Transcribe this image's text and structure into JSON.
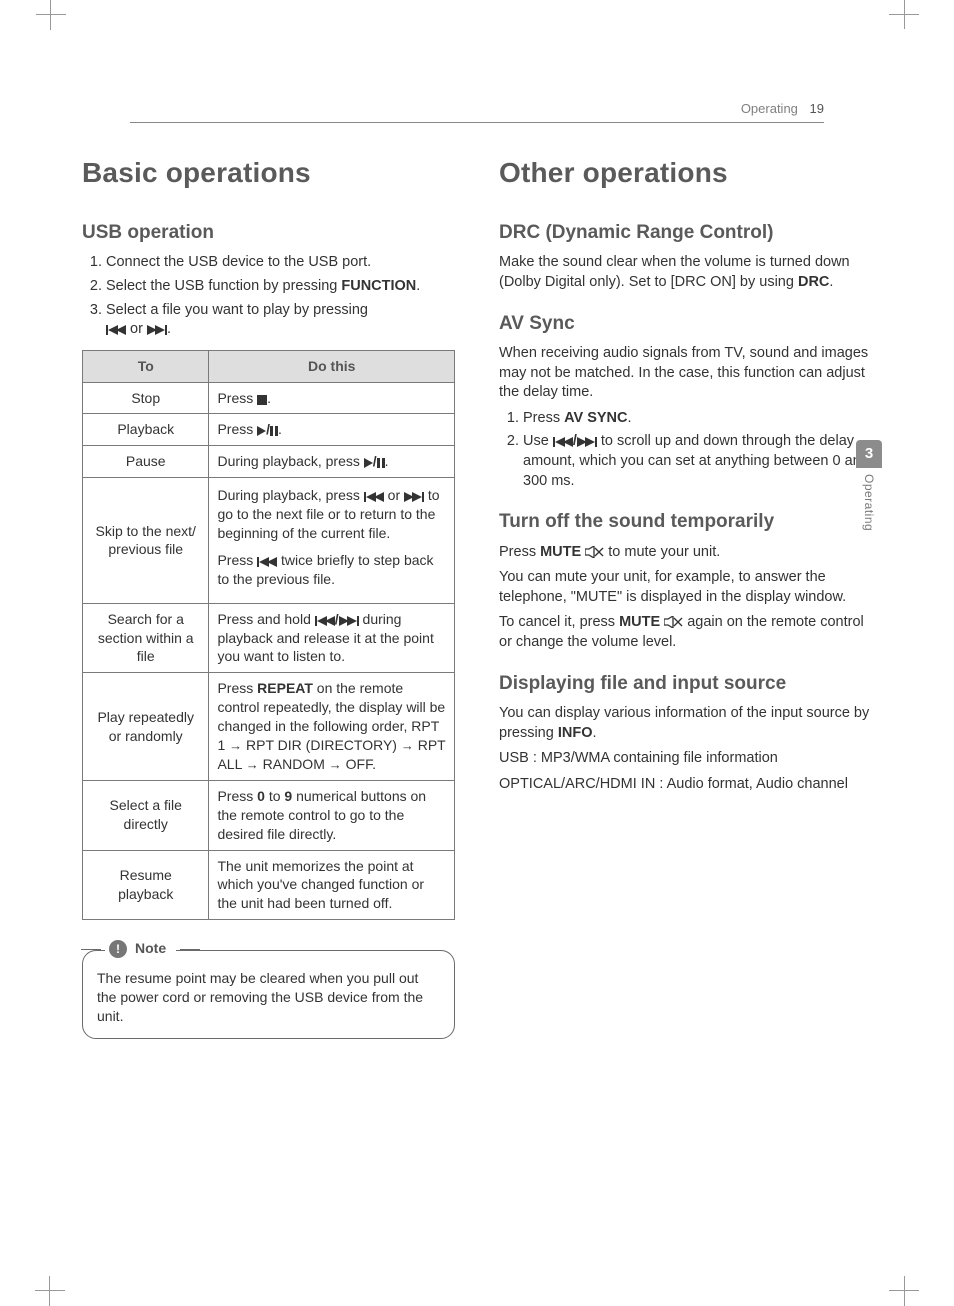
{
  "header": {
    "section": "Operating",
    "page": "19"
  },
  "sidetab": {
    "number": "3",
    "label": "Operating"
  },
  "left": {
    "h1": "Basic operations",
    "usb_h2": "USB operation",
    "steps": {
      "s1": "Connect the USB device to the USB port.",
      "s2_a": "Select the USB function by pressing ",
      "s2_b": "FUNCTION",
      "s3_a": "Select a file you want to play by pressing ",
      "s3_b": " or "
    },
    "table": {
      "th_to": "To",
      "th_do": "Do this",
      "stop_to": "Stop",
      "stop_do": "Press ",
      "play_to": "Playback",
      "play_do": "Press ",
      "pause_to": "Pause",
      "pause_do": "During playback, press ",
      "skip_to": "Skip to the next/ previous file",
      "skip_do_a": "During playback, press ",
      "skip_do_b": " or ",
      "skip_do_c": " to go to the next file or to return to the beginning of the current file.",
      "skip_do_d": "Press ",
      "skip_do_e": " twice briefly to step back to the previous file.",
      "search_to": "Search for a section within a file",
      "search_do_a": "Press and hold ",
      "search_do_b": " during playback and release it at the point you want to listen to.",
      "repeat_to": "Play repeatedly or randomly",
      "repeat_do_a": "Press ",
      "repeat_do_b": "REPEAT",
      "repeat_do_c": " on the remote control repeatedly, the display will be changed in the following order, RPT 1 ",
      "repeat_do_d": " RPT DIR (DIRECTORY) ",
      "repeat_do_e": " RPT ALL ",
      "repeat_do_f": " RANDOM ",
      "repeat_do_g": " OFF.",
      "direct_to": "Select a file directly",
      "direct_do_a": "Press ",
      "direct_do_b": "0",
      "direct_do_c": " to ",
      "direct_do_d": "9",
      "direct_do_e": " numerical buttons on the remote control to go to the desired file directly.",
      "resume_to": "Resume playback",
      "resume_do": "The unit memorizes the point at which you've changed function or the unit had been turned off."
    },
    "note_title": "Note",
    "note_body": "The resume point may be cleared when you pull out the power cord or removing the USB device from the unit."
  },
  "right": {
    "h1": "Other operations",
    "drc_h2": "DRC (Dynamic Range Control)",
    "drc_p_a": "Make the sound clear when the volume is turned down (Dolby Digital only). Set to [DRC ON] by using ",
    "drc_p_b": "DRC",
    "av_h2": "AV Sync",
    "av_p": "When receiving audio signals from TV, sound and images may not be matched. In the case, this function can adjust the delay time.",
    "av_s1_a": "Press ",
    "av_s1_b": "AV SYNC",
    "av_s2_a": "Use ",
    "av_s2_b": " to scroll up and down through the delay amount, which you can set at anything between 0 and 300 ms.",
    "mute_h2": "Turn off the sound temporarily",
    "mute_p1_a": "Press ",
    "mute_p1_b": "MUTE",
    "mute_p1_c": " to mute your unit.",
    "mute_p2": "You can mute your unit, for example, to answer the telephone, \"MUTE\" is displayed in the display window.",
    "mute_p3_a": "To cancel it, press ",
    "mute_p3_b": "MUTE",
    "mute_p3_c": " again on the remote control or change the volume level.",
    "disp_h2": "Displaying file and input source",
    "disp_p1_a": "You can display various information of the input source by pressing ",
    "disp_p1_b": "INFO",
    "disp_p2": "USB : MP3/WMA containing file information",
    "disp_p3": "OPTICAL/ARC/HDMI IN : Audio format, Audio channel"
  }
}
